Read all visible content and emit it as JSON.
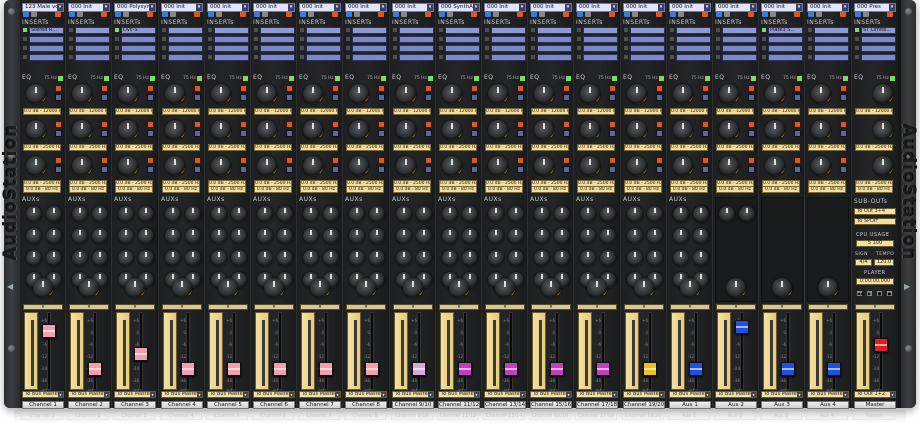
{
  "app": {
    "brand": "AudioStation"
  },
  "sections": {
    "inserts": "INSERTs",
    "eq": "EQ",
    "auxs": "AUXs"
  },
  "eq_values": {
    "band1": "0.0 dB - 12000 Hz",
    "band2": "0.0 dB - 2500 Hz",
    "band3": "0.0 dB - 2500 Hz",
    "band4": "0.0 dB - 80 Hz",
    "band_small": "0 dB",
    "freq_label": "75 Hz"
  },
  "fader_scale": [
    "+6",
    "0",
    "-6",
    "-12",
    "-24",
    "-36",
    "-inf"
  ],
  "channels": [
    {
      "name": "Channel 1",
      "instrument": "123 Male voice",
      "insert1": "Stereo R...",
      "route": "To Bus Master",
      "fader_color": "#f0a0b0",
      "fader_level": 0.82
    },
    {
      "name": "Channel 2",
      "instrument": "000 Init",
      "insert1": "",
      "route": "To Bus Master",
      "fader_color": "#f0a0b0",
      "fader_level": 0.22
    },
    {
      "name": "Channel 3",
      "instrument": "000 Polysynth...",
      "insert1": "Dvc-S",
      "route": "To Bus Master",
      "fader_color": "#f0a0b0",
      "fader_level": 0.45
    },
    {
      "name": "Channel 4",
      "instrument": "000 Init",
      "insert1": "",
      "route": "To Bus Master",
      "fader_color": "#f0a0b0",
      "fader_level": 0.22
    },
    {
      "name": "Channel 5",
      "instrument": "000 Init",
      "insert1": "",
      "route": "To Bus Master",
      "fader_color": "#f0a0b0",
      "fader_level": 0.22
    },
    {
      "name": "Channel 6",
      "instrument": "000 Init",
      "insert1": "",
      "route": "To Bus Master",
      "fader_color": "#f0a0b0",
      "fader_level": 0.22
    },
    {
      "name": "Channel 7",
      "instrument": "000 Init",
      "insert1": "",
      "route": "To Bus Master",
      "fader_color": "#f0a0b0",
      "fader_level": 0.22
    },
    {
      "name": "Channel 8",
      "instrument": "000 Init",
      "insert1": "",
      "route": "To Bus Master",
      "fader_color": "#f0a0b0",
      "fader_level": 0.22
    },
    {
      "name": "Channel 9/10",
      "instrument": "000 Init",
      "insert1": "",
      "route": "To Bus Master",
      "fader_color": "#d8a8d8",
      "fader_level": 0.22
    },
    {
      "name": "Channel 11/12",
      "instrument": "000 SynthAna...",
      "insert1": "",
      "route": "To Bus Master",
      "fader_color": "#c040c0",
      "fader_level": 0.22
    },
    {
      "name": "Channel 13/14",
      "instrument": "000 Init",
      "insert1": "",
      "route": "To Bus Master",
      "fader_color": "#c040c0",
      "fader_level": 0.22
    },
    {
      "name": "Channel 15/16",
      "instrument": "000 Init",
      "insert1": "",
      "route": "To Bus Master",
      "fader_color": "#c040c0",
      "fader_level": 0.22
    },
    {
      "name": "Channel 17/18",
      "instrument": "000 Init",
      "insert1": "",
      "route": "To Bus Master",
      "fader_color": "#c040c0",
      "fader_level": 0.22
    },
    {
      "name": "Channel 19/20",
      "instrument": "000 Init",
      "insert1": "",
      "route": "To Bus Master",
      "fader_color": "#f0c020",
      "fader_level": 0.22
    },
    {
      "name": "Aux 1",
      "instrument": "000 Init",
      "insert1": "",
      "route": "To Bus Master",
      "fader_color": "#2050e0",
      "fader_level": 0.22
    },
    {
      "name": "Aux 2",
      "instrument": "000 Init",
      "insert1": "",
      "route": "To Bus Master",
      "fader_color": "#2050e0",
      "fader_level": 0.88
    },
    {
      "name": "Aux 3",
      "instrument": "000 Init",
      "insert1": "Plate3 S...",
      "route": "To Bus Master",
      "fader_color": "#2050e0",
      "fader_level": 0.22
    },
    {
      "name": "Aux 4",
      "instrument": "000 Init",
      "insert1": "",
      "route": "To Bus Master",
      "fader_color": "#2050e0",
      "fader_level": 0.22
    }
  ],
  "master": {
    "name": "Master",
    "instrument": "000 Pres",
    "insert1": "ST Limite...",
    "route": "To Out 1+2",
    "fader_color": "#e02020",
    "fader_level": 0.6,
    "subouts_label": "SUB-OUTs",
    "subout1": "To Out 3+4",
    "subout2": "To SPDIF",
    "cpu_label": "CPU USAGE",
    "cpu_value": "5",
    "cpu_max": "100",
    "sign_label": "SIGN",
    "tempo_label": "TEMPO",
    "sign_value": "4/4",
    "tempo_value": "120.0",
    "player_label": "PLAYER",
    "player_time": "0:00:00.000"
  }
}
